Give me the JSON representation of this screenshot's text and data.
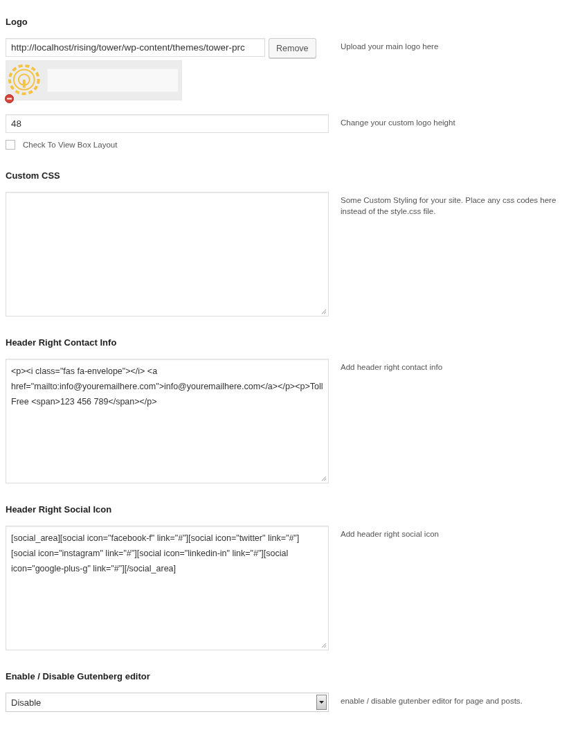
{
  "sections": [
    {
      "kind": "logo",
      "title": "Logo",
      "value": "http://localhost/rising/tower/wp-content/themes/tower-prc",
      "button": "Remove",
      "description": "Upload your main logo here"
    },
    {
      "kind": "text",
      "value": "48",
      "description": "Change your custom logo height"
    },
    {
      "kind": "checkbox",
      "label": "Check To View Box Layout",
      "checked": false
    },
    {
      "kind": "textarea",
      "title": "Custom CSS",
      "description": "Some Custom Styling for your site. Place any css codes here instead of the style.css file."
    },
    {
      "kind": "textarea",
      "title": "Header Right Contact Info",
      "value": "<p><i class=\"fas fa-envelope\"></i> <a href=\"mailto:info@youremailhere.com\">info@youremailhere.com</a></p><p>Toll Free <span>123 456 789</span></p>",
      "description": "Add header right contact info"
    },
    {
      "kind": "textarea",
      "title": "Header Right Social Icon",
      "value": "[social_area][social icon=\"facebook-f\" link=\"#\"][social icon=\"twitter\" link=\"#\"][social icon=\"instagram\" link=\"#\"][social icon=\"linkedin-in\" link=\"#\"][social icon=\"google-plus-g\" link=\"#\"][/social_area]",
      "description": "Add header right social icon"
    },
    {
      "kind": "select",
      "title": "Enable / Disable Gutenberg editor",
      "value": "Disable",
      "description": "enable / disable gutenber editor for page and posts."
    }
  ]
}
